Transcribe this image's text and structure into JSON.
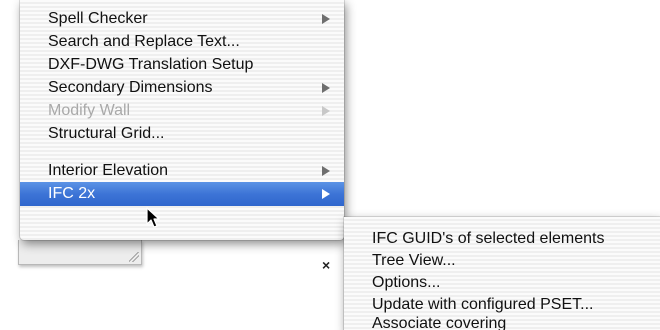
{
  "main_menu": {
    "items": [
      {
        "label": "Spell Checker",
        "submenu": true,
        "state": "normal"
      },
      {
        "label": "Search and Replace Text...",
        "submenu": false,
        "state": "normal"
      },
      {
        "label": "DXF-DWG Translation Setup",
        "submenu": false,
        "state": "normal"
      },
      {
        "label": "Secondary Dimensions",
        "submenu": true,
        "state": "normal"
      },
      {
        "label": "Modify Wall",
        "submenu": true,
        "state": "disabled"
      },
      {
        "label": "Structural Grid...",
        "submenu": false,
        "state": "normal"
      },
      {
        "label": "Interior Elevation",
        "submenu": true,
        "state": "normal"
      },
      {
        "label": "IFC 2x",
        "submenu": true,
        "state": "selected"
      }
    ]
  },
  "submenu": {
    "parent": "IFC 2x",
    "items": [
      {
        "label": "IFC GUID's of selected elements"
      },
      {
        "label": "Tree View..."
      },
      {
        "label": "Options..."
      },
      {
        "label": "Update with configured PSET..."
      },
      {
        "label": "Associate covering"
      }
    ]
  },
  "background_window": {
    "close_glyph": "×"
  },
  "icons": {
    "submenu_arrow": "triangle-right-icon",
    "cursor": "arrow-pointer-icon",
    "close": "close-icon",
    "resize": "resize-grip-icon"
  },
  "colors": {
    "selection": "#3d74d6",
    "disabled_text": "#a9a9a9",
    "menu_text": "#111111"
  }
}
